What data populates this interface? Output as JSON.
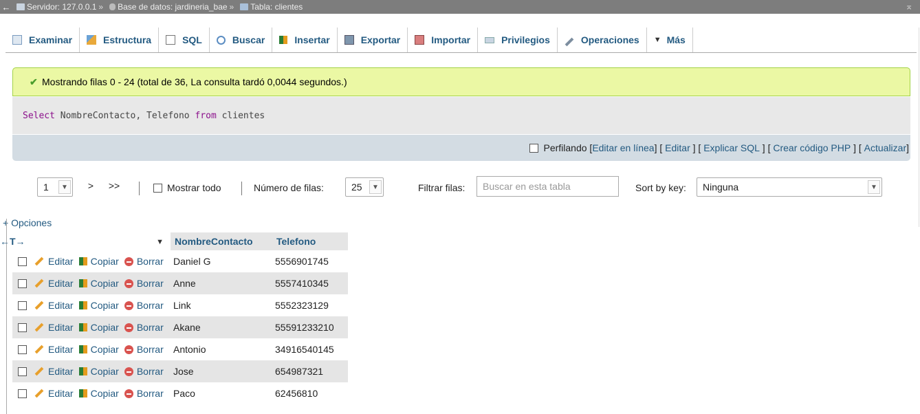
{
  "breadcrumb": {
    "back": "←",
    "server": "Servidor: 127.0.0.1",
    "database": "Base de datos: jardineria_bae",
    "table": "Tabla: clientes",
    "separator": "»",
    "collapse": "⌅"
  },
  "tabs": [
    {
      "label": "Examinar",
      "icon": "browse-icon"
    },
    {
      "label": "Estructura",
      "icon": "structure-icon"
    },
    {
      "label": "SQL",
      "icon": "sql-icon"
    },
    {
      "label": "Buscar",
      "icon": "search-icon"
    },
    {
      "label": "Insertar",
      "icon": "insert-icon"
    },
    {
      "label": "Exportar",
      "icon": "export-icon"
    },
    {
      "label": "Importar",
      "icon": "import-icon"
    },
    {
      "label": "Privilegios",
      "icon": "privileges-icon"
    },
    {
      "label": "Operaciones",
      "icon": "wrench-icon"
    },
    {
      "label": "Más",
      "icon": "triangle-down-icon"
    }
  ],
  "message": {
    "text": "Mostrando filas 0 - 24 (total de 36, La consulta tardó 0,0044 segundos.)",
    "color": "#ebf8a4"
  },
  "query": {
    "kw1": "Select",
    "part1": " NombreContacto, Telefono ",
    "kw2": "from",
    "part2": " clientes"
  },
  "profiling": {
    "label": "Perfilando",
    "links": [
      "Editar en línea",
      "Editar",
      "Explicar SQL",
      "Crear código PHP",
      "Actualizar"
    ]
  },
  "navigation": {
    "page": "1",
    "next": ">",
    "last": ">>",
    "show_all": "Mostrar todo",
    "rows_label": "Número de filas:",
    "rows_value": "25",
    "filter_label": "Filtrar filas:",
    "filter_placeholder": "Buscar en esta tabla",
    "sort_label": "Sort by key:",
    "sort_value": "Ninguna"
  },
  "options_link": "+ Opciones",
  "table": {
    "arrows": "←T→",
    "sort_triangle": "▼",
    "columns": [
      "NombreContacto",
      "Telefono"
    ],
    "actions": {
      "edit": "Editar",
      "copy": "Copiar",
      "delete": "Borrar"
    },
    "rows": [
      {
        "name": "Daniel G",
        "phone": "5556901745"
      },
      {
        "name": "Anne",
        "phone": "5557410345"
      },
      {
        "name": "Link",
        "phone": "5552323129"
      },
      {
        "name": "Akane",
        "phone": "55591233210"
      },
      {
        "name": "Antonio",
        "phone": "34916540145"
      },
      {
        "name": "Jose",
        "phone": "654987321"
      },
      {
        "name": "Paco",
        "phone": "62456810"
      }
    ]
  },
  "colors": {
    "link": "#235a81",
    "success_border": "#a2d246",
    "sql_bg": "#e8e8e8",
    "profile_bg": "#d3dce3"
  }
}
